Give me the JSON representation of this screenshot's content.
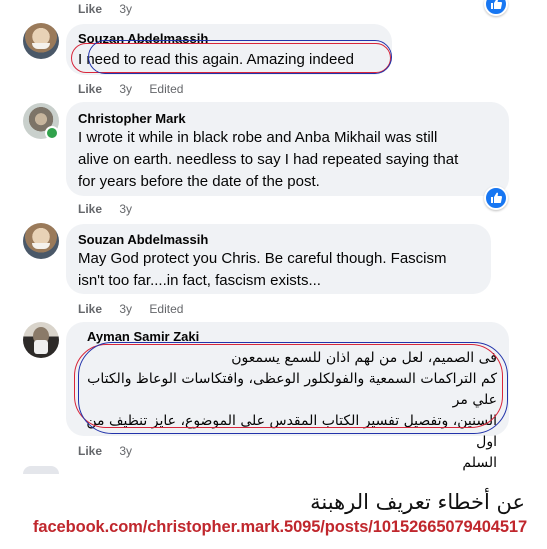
{
  "comments": [
    {
      "author": "",
      "text": "",
      "actions": {
        "like": "Like",
        "time": "3y",
        "edited": ""
      }
    },
    {
      "author": "Souzan Abdelmassih",
      "text": "I need to read this again. Amazing indeed",
      "actions": {
        "like": "Like",
        "time": "3y",
        "edited": "Edited"
      }
    },
    {
      "author": "Christopher Mark",
      "text_lines": [
        "I wrote it while in black robe and Anba Mikhail was still",
        "alive on earth. needless to say I had repeated saying that",
        "for years before the date of the post."
      ],
      "actions": {
        "like": "Like",
        "time": "3y"
      }
    },
    {
      "author": "Souzan Abdelmassih",
      "text_lines": [
        "May God protect you Chris. Be careful though. Fascism",
        "isn't too far....in fact, fascism exists..."
      ],
      "actions": {
        "like": "Like",
        "time": "3y",
        "edited": "Edited"
      }
    },
    {
      "author": "Ayman Samir Zaki",
      "text_lines": [
        "فى الصميم، لعل من لهم اذان للسمع يسمعون",
        "كم التراكمات السمعية والفولكلور الوعظى، وافتكاسات الوعاظ والكتاب علي مر",
        "السنين، وتفصيل تفسير الكتاب المقدس على الموضوع، عايز تنظيف من اول",
        "السلم"
      ],
      "actions": {
        "like": "Like",
        "time": "3y"
      }
    }
  ],
  "icons": [
    "like-reaction-icon",
    "online-status-icon"
  ],
  "caption": {
    "title": "عن أخطاء تعريف الرهبنة",
    "url": "facebook.com/christopher.mark.5095/posts/10152665079404517"
  },
  "colors": {
    "bubble": "#f0f2f5",
    "meta_text": "#65676b",
    "like_reaction": "#1877f2",
    "annotation_red": "#d8263a",
    "annotation_blue": "#2233aa",
    "url_red": "#c0272d"
  }
}
